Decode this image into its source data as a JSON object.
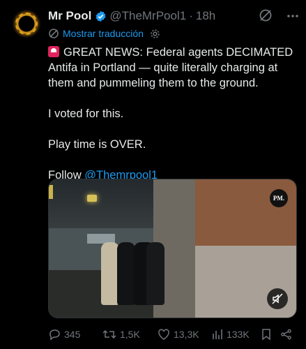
{
  "author": {
    "name": "Mr Pool",
    "handle": "@TheMrPool1",
    "separator": "·",
    "time": "18h",
    "verified": true
  },
  "translate": {
    "label": "Mostrar traducción"
  },
  "post": {
    "line1": "GREAT NEWS: Federal agents DECIMATED Antifa in Portland — quite literally charging at them and pummeling them to the ground.",
    "line2": "I voted for this.",
    "line3": "Play time is OVER.",
    "follow_prefix": "Follow",
    "mention": "@Themrpool1"
  },
  "media": {
    "watermark": "PM."
  },
  "actions": {
    "replies": "345",
    "reposts": "1,5K",
    "likes": "13,3K",
    "views": "133K"
  },
  "colors": {
    "accent": "#1d9bf0",
    "muted": "#71767b",
    "text": "#e7e9ea",
    "background": "#000000"
  }
}
